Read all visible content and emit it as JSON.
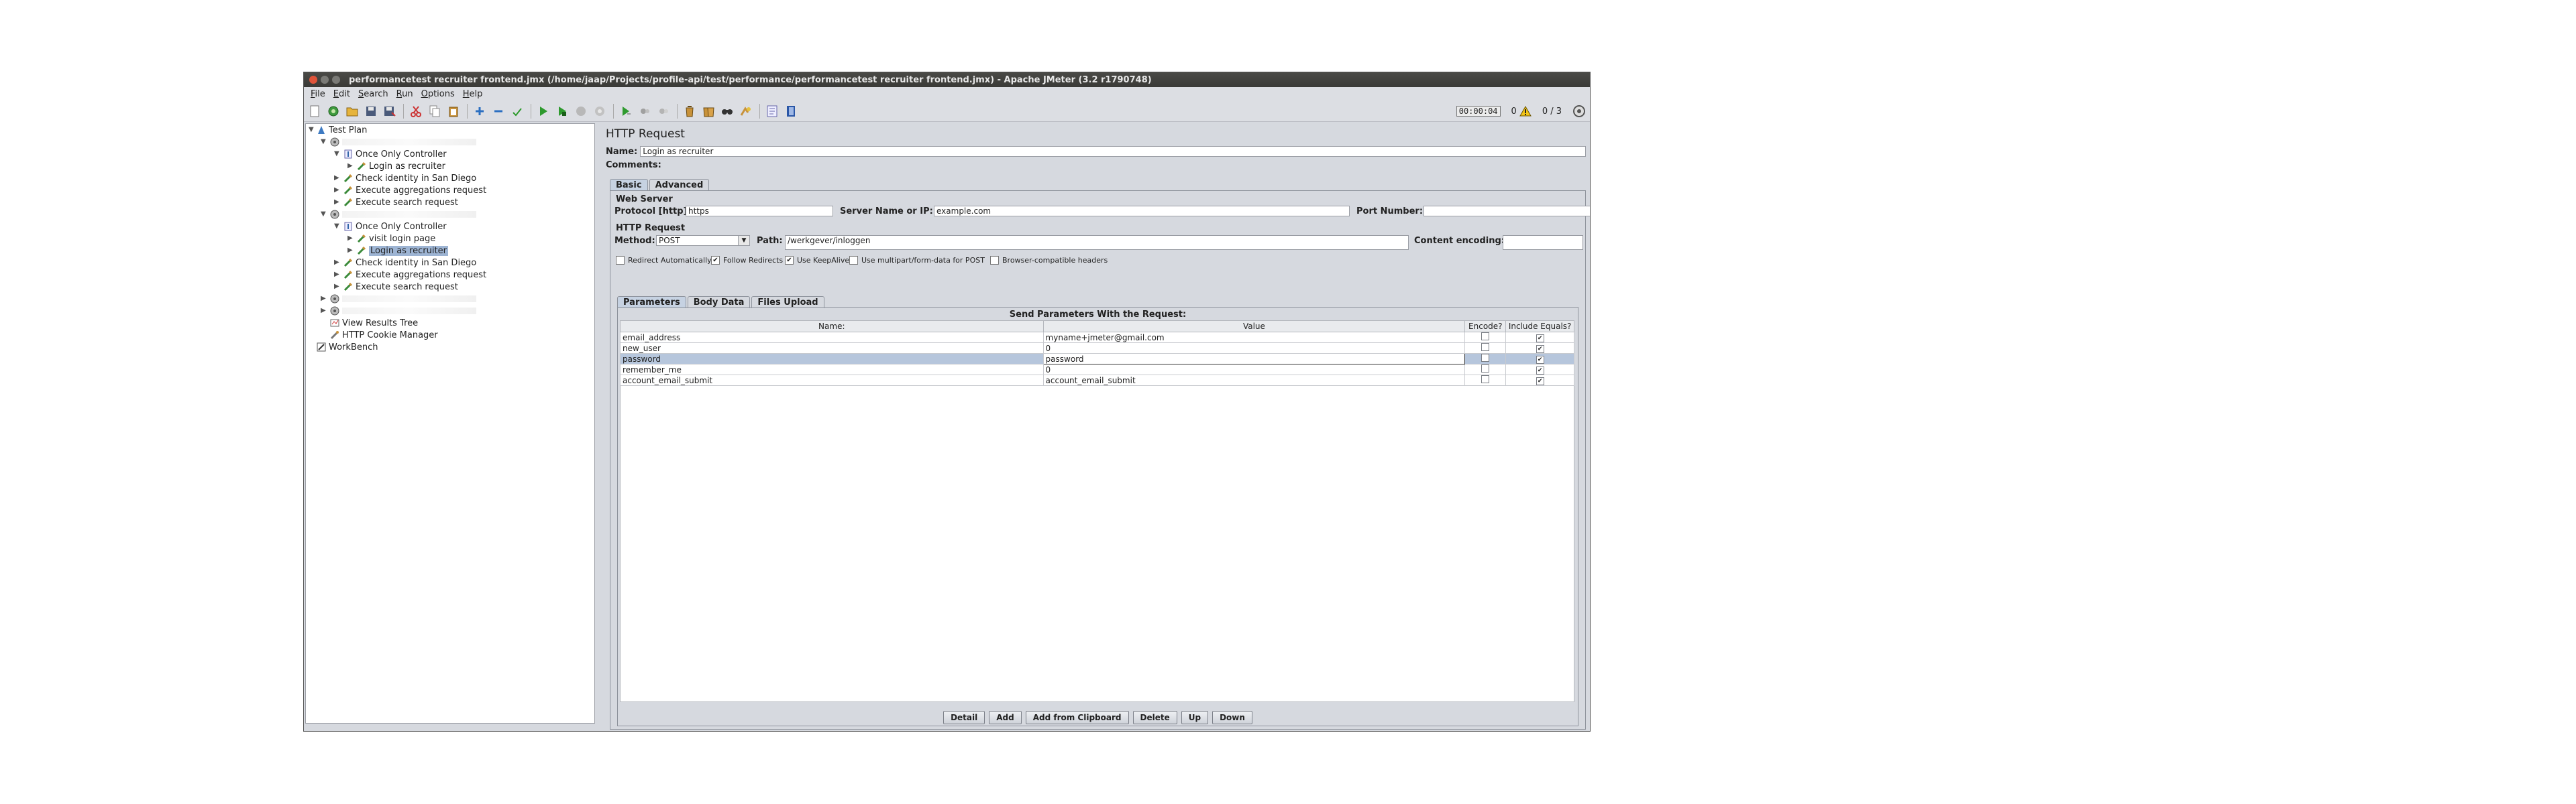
{
  "window": {
    "title": "performancetest recruiter frontend.jmx (/home/jaap/Projects/profile-api/test/performance/performancetest recruiter frontend.jmx) - Apache JMeter (3.2 r1790748)"
  },
  "menu": [
    "File",
    "Edit",
    "Search",
    "Run",
    "Options",
    "Help"
  ],
  "toolbar": {
    "icons": [
      "new-icon",
      "templates-icon",
      "open-icon",
      "save-icon",
      "save-as-icon",
      "cut-icon",
      "copy-icon",
      "paste-icon",
      "expand-icon",
      "collapse-icon",
      "toggle-icon",
      "start-icon",
      "start-no-pauses-icon",
      "stop-icon",
      "shutdown-icon",
      "remote-start-icon",
      "remote-stop-icon",
      "remote-shutdown-icon",
      "clear-icon",
      "clear-all-icon",
      "search-icon",
      "reset-search-icon",
      "function-helper-icon",
      "help-icon"
    ],
    "timer": "00:00:04",
    "warnings": "0",
    "threads": "0 / 3"
  },
  "tree": {
    "test_plan": "Test Plan",
    "group1": {
      "once_only": "Once Only Controller",
      "login": "Login as recruiter",
      "check_identity": "Check identity in San Diego",
      "execute_aggregations": "Execute aggregations request",
      "execute_search": "Execute search request"
    },
    "group2": {
      "once_only": "Once Only Controller",
      "visit_login": "visit login page",
      "login": "Login as recruiter",
      "check_identity": "Check identity in San Diego",
      "execute_aggregations": "Execute aggregations request",
      "execute_search": "Execute search request"
    },
    "view_results": "View Results Tree",
    "cookie_manager": "HTTP Cookie Manager",
    "workbench": "WorkBench"
  },
  "request": {
    "heading": "HTTP Request",
    "name_label": "Name:",
    "name_value": "Login as recruiter",
    "comments_label": "Comments:",
    "tabs": [
      "Basic",
      "Advanced"
    ],
    "web_server_title": "Web Server",
    "protocol_label": "Protocol [http]:",
    "protocol_value": "https",
    "server_label": "Server Name or IP:",
    "server_value": "example.com",
    "port_label": "Port Number:",
    "port_value": "",
    "http_request_title": "HTTP Request",
    "method_label": "Method:",
    "method_value": "POST",
    "path_label": "Path:",
    "path_value": "/werkgever/inloggen",
    "encoding_label": "Content encoding:",
    "encoding_value": "",
    "options": [
      {
        "label": "Redirect Automatically",
        "checked": false
      },
      {
        "label": "Follow Redirects",
        "checked": true
      },
      {
        "label": "Use KeepAlive",
        "checked": true
      },
      {
        "label": "Use multipart/form-data for POST",
        "checked": false
      },
      {
        "label": "Browser-compatible headers",
        "checked": false
      }
    ],
    "subtabs": [
      "Parameters",
      "Body Data",
      "Files Upload"
    ],
    "params_title": "Send Parameters With the Request:",
    "columns": [
      "Name:",
      "Value",
      "Encode?",
      "Include Equals?"
    ],
    "params": [
      {
        "name": "email_address",
        "value": "myname+jmeter@gmail.com",
        "encode": false,
        "include": true
      },
      {
        "name": "new_user",
        "value": "0",
        "encode": false,
        "include": true
      },
      {
        "name": "password",
        "value": "password",
        "encode": false,
        "include": true
      },
      {
        "name": "remember_me",
        "value": "0",
        "encode": false,
        "include": true
      },
      {
        "name": "account_email_submit",
        "value": "account_email_submit",
        "encode": false,
        "include": true
      }
    ],
    "buttons": [
      "Detail",
      "Add",
      "Add from Clipboard",
      "Delete",
      "Up",
      "Down"
    ]
  }
}
